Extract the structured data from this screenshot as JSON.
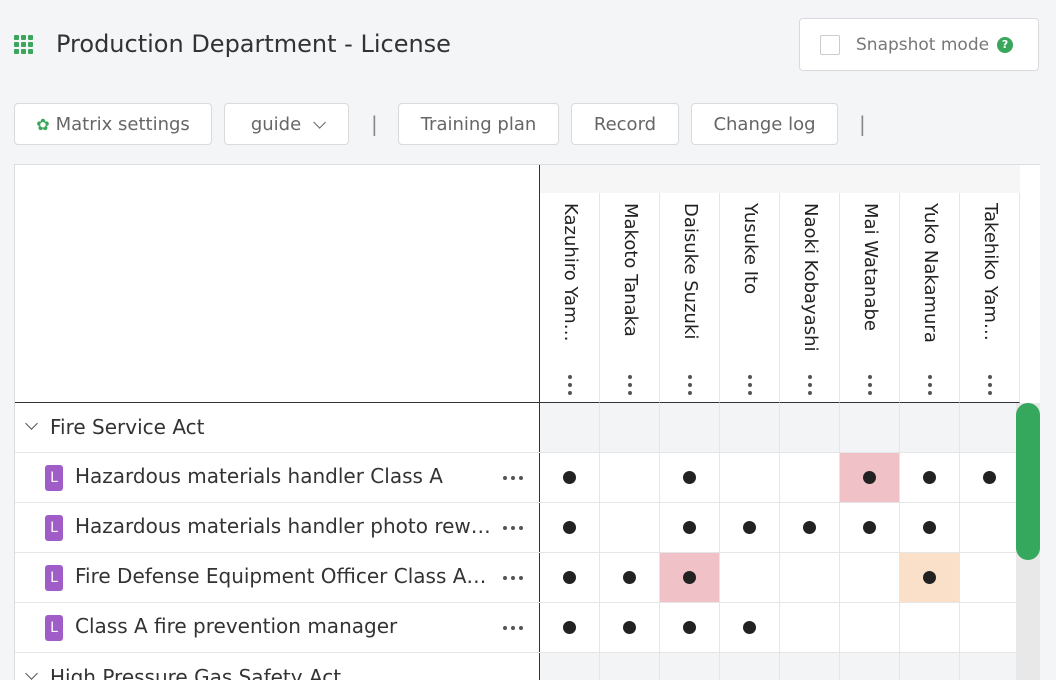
{
  "header": {
    "title": "Production Department - License",
    "snapshot_label": "Snapshot mode",
    "help_glyph": "?"
  },
  "toolbar": {
    "matrix_settings": "Matrix settings",
    "guide": "guide",
    "separator": "|",
    "training_plan": "Training plan",
    "record": "Record",
    "change_log": "Change log"
  },
  "colors": {
    "brand_green": "#3aa65c",
    "badge_purple": "#a05dc8",
    "highlight_red": "#f0c1c6",
    "highlight_orange": "#fae0c8"
  },
  "columns": [
    "Kazuhiro Yam…",
    "Makoto Tanaka",
    "Daisuke Suzuki",
    "Yusuke Ito",
    "Naoki Kobayashi",
    "Mai Watanabe",
    "Yuko Nakamura",
    "Takehiko Yam…"
  ],
  "rows": [
    {
      "type": "group",
      "label": "Fire Service Act"
    },
    {
      "type": "item",
      "badge": "L",
      "label": "Hazardous materials handler Class A",
      "marks": [
        1,
        0,
        1,
        0,
        0,
        1,
        1,
        1
      ],
      "highlights": [
        null,
        null,
        null,
        null,
        null,
        "red",
        null,
        null
      ]
    },
    {
      "type": "item",
      "badge": "L",
      "label": "Hazardous materials handler photo rew…",
      "marks": [
        1,
        0,
        1,
        1,
        1,
        1,
        1,
        0
      ],
      "highlights": [
        null,
        null,
        null,
        null,
        null,
        null,
        null,
        null
      ]
    },
    {
      "type": "item",
      "badge": "L",
      "label": "Fire Defense Equipment Officer Class A…",
      "marks": [
        1,
        1,
        1,
        0,
        0,
        0,
        1,
        0
      ],
      "highlights": [
        null,
        null,
        "red",
        null,
        null,
        null,
        "orange",
        null
      ]
    },
    {
      "type": "item",
      "badge": "L",
      "label": "Class A fire prevention manager",
      "marks": [
        1,
        1,
        1,
        1,
        0,
        0,
        0,
        0
      ],
      "highlights": [
        null,
        null,
        null,
        null,
        null,
        null,
        null,
        null
      ]
    },
    {
      "type": "group",
      "label": "High Pressure Gas Safety Act"
    }
  ]
}
